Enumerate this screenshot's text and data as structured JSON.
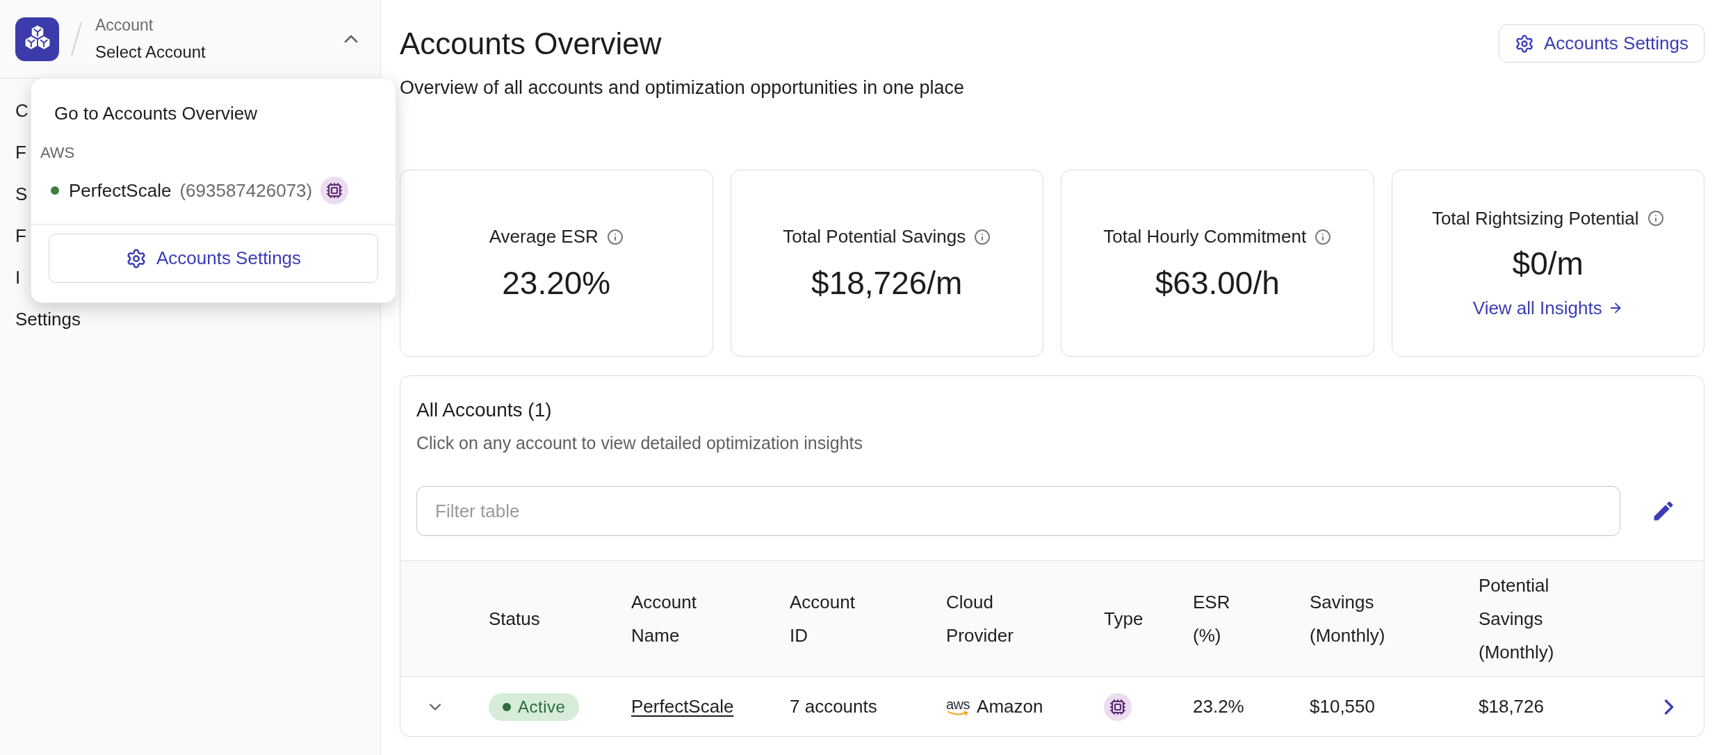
{
  "sidebar": {
    "account_selector": {
      "label": "Account",
      "value": "Select Account",
      "expanded": true
    },
    "items": [
      {
        "label": "C"
      },
      {
        "label": "F"
      },
      {
        "label": "S"
      },
      {
        "label": "F"
      },
      {
        "label": "I"
      },
      {
        "label": "Settings"
      }
    ]
  },
  "account_menu": {
    "overview_link": "Go to Accounts Overview",
    "groups": [
      {
        "label": "AWS",
        "accounts": [
          {
            "name": "PerfectScale",
            "id": "(693587426073)",
            "active": true
          }
        ]
      }
    ],
    "settings_button": "Accounts Settings"
  },
  "header": {
    "title": "Accounts Overview",
    "subtitle": "Overview of all accounts and optimization opportunities in one place",
    "settings_button": "Accounts Settings"
  },
  "stat_cards": [
    {
      "label": "Average ESR",
      "value": "23.20%"
    },
    {
      "label": "Total Potential Savings",
      "value": "$18,726/m"
    },
    {
      "label": "Total Hourly Commitment",
      "value": "$63.00/h"
    },
    {
      "label": "Total Rightsizing Potential",
      "value": "$0/m",
      "link": "View all Insights"
    }
  ],
  "accounts_table": {
    "title": "All Accounts (1)",
    "subtitle": "Click on any account to view detailed optimization insights",
    "filter": {
      "placeholder": "Filter table"
    },
    "columns": [
      "Status",
      "Account Name",
      "Account ID",
      "Cloud Provider",
      "Type",
      "ESR (%)",
      "Savings (Monthly)",
      "Potential Savings (Monthly)"
    ],
    "rows": [
      {
        "expanded": false,
        "status": {
          "label": "Active",
          "kind": "active"
        },
        "account_name": "PerfectScale",
        "account_id": "7 accounts",
        "provider_logo": "aws",
        "cloud_provider": "Amazon",
        "esr": "23.2%",
        "savings": "$10,550",
        "potential_savings": "$18,726"
      }
    ]
  }
}
